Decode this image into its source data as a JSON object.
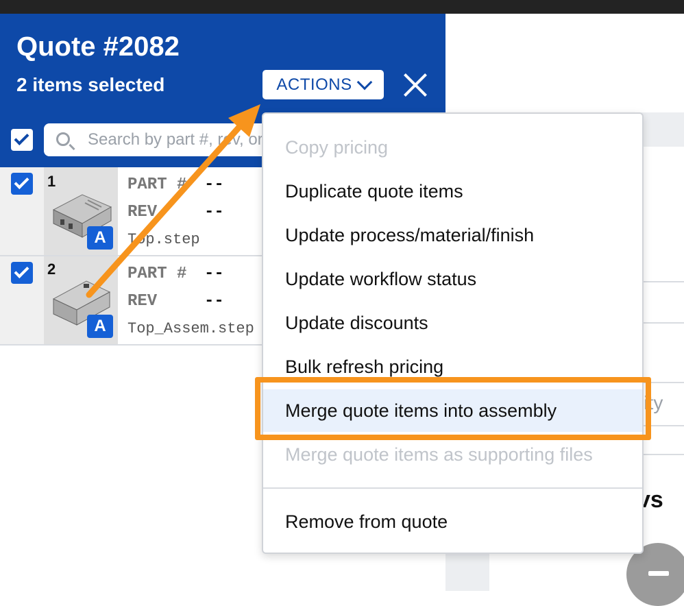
{
  "header": {
    "title": "Quote #2082",
    "selected_count": "2 items selected",
    "actions_label": "ACTIONS"
  },
  "search": {
    "placeholder": "Search by part #, rev, or"
  },
  "items": [
    {
      "number": "1",
      "badge": "A",
      "part_label": "PART #",
      "part_value": "--",
      "rev_label": "REV",
      "rev_value": "--",
      "filename": "Top.step"
    },
    {
      "number": "2",
      "badge": "A",
      "part_label": "PART #",
      "part_value": "--",
      "rev_label": "REV",
      "rev_value": "--",
      "filename": "Top_Assem.step"
    }
  ],
  "menu": {
    "items": [
      {
        "label": "Copy pricing",
        "disabled": true
      },
      {
        "label": "Duplicate quote items",
        "disabled": false
      },
      {
        "label": "Update process/material/finish",
        "disabled": false
      },
      {
        "label": "Update workflow status",
        "disabled": false
      },
      {
        "label": "Update discounts",
        "disabled": false
      },
      {
        "label": "Bulk refresh pricing",
        "disabled": false
      },
      {
        "label": "Merge quote items into assembly",
        "disabled": false,
        "highlighted": true
      },
      {
        "label": "Merge quote items as supporting files",
        "disabled": true
      }
    ],
    "remove_label": "Remove from quote"
  },
  "right_panel": {
    "fragment_text": "rity",
    "fragment_bold": "vs"
  },
  "colors": {
    "brand_blue": "#0e49a8",
    "check_blue": "#1560d6",
    "annotation_orange": "#f7941d",
    "menu_hover": "#e9f1fc"
  },
  "icons": {
    "search": "search-icon",
    "close": "close-icon",
    "chevron": "chevron-down-icon",
    "check": "check-icon",
    "minus": "minus-icon"
  }
}
